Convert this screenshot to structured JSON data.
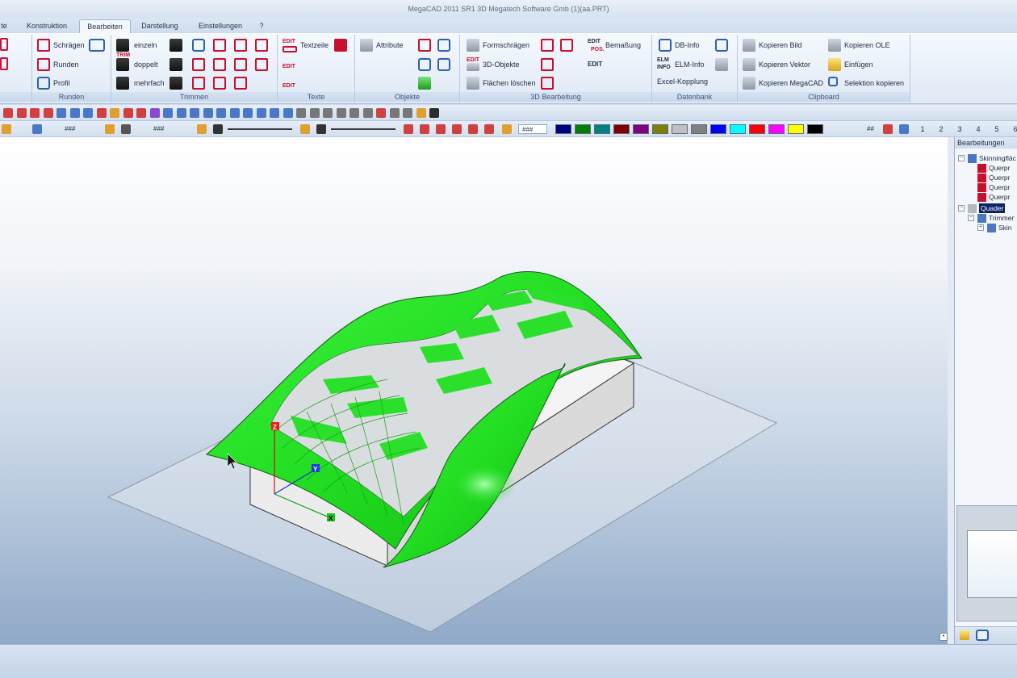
{
  "window": {
    "title": "MegaCAD 2011 SR1 3D  Megatech Software Gmb (1)(aa.PRT)"
  },
  "tabs": [
    {
      "label": "te"
    },
    {
      "label": "Konstruktion"
    },
    {
      "label": "Bearbeiten",
      "active": true
    },
    {
      "label": "Darstellung"
    },
    {
      "label": "Einstellungen"
    },
    {
      "label": "?"
    }
  ],
  "ribbon": {
    "groups": {
      "runden": {
        "label": "Runden",
        "items": [
          "Schrägen",
          "Runden",
          "Profil"
        ]
      },
      "trimmen": {
        "label": "Trimmen",
        "items": [
          "einzeln",
          "doppelt",
          "mehrfach"
        ]
      },
      "texte": {
        "label": "Texte",
        "items": [
          "Textzeile"
        ]
      },
      "objekte": {
        "label": "Objekte",
        "items": [
          "Attribute"
        ]
      },
      "bearbeitung3d": {
        "label": "3D Bearbeitung",
        "items": [
          "Formschrägen",
          "3D-Objekte",
          "Flächen löschen",
          "Bemaßung",
          "EDIT"
        ]
      },
      "datenbank": {
        "label": "Datenbank",
        "items": [
          "DB-Info",
          "ELM-Info",
          "Excel-Kopplung"
        ]
      },
      "clipboard": {
        "label": "Clipboard",
        "items": [
          "Kopieren Bild",
          "Kopieren OLE",
          "Kopieren Vektor",
          "Einfügen",
          "Kopieren MegaCAD",
          "Selektion kopieren"
        ]
      }
    },
    "icon_texts": {
      "trim": "TRIM",
      "edit": "EDIT",
      "pos": "POS.",
      "elm": "ELM",
      "info": "INFO"
    }
  },
  "toolbar2": {
    "hash1": "###",
    "hash2": "###",
    "hash3": "###",
    "grid_label": "##",
    "colors": [
      "#ffffff",
      "#000080",
      "#008000",
      "#008080",
      "#800000",
      "#800080",
      "#808000",
      "#c0c0c0",
      "#808080",
      "#0000ff",
      "#00ffff",
      "#ff0000",
      "#ff00ff",
      "#ffff00",
      "#000000"
    ],
    "layers": [
      "1",
      "2",
      "3",
      "4",
      "5",
      "6"
    ]
  },
  "viewport": {
    "accent": "#22dd22",
    "axes": {
      "x": "X",
      "y": "Y",
      "z": "Z"
    }
  },
  "panel": {
    "title": "Bearbeitungen",
    "tree": [
      {
        "label": "Skinningfläc",
        "level": 0,
        "expander": "⊟"
      },
      {
        "label": "Querpr",
        "level": 1
      },
      {
        "label": "Querpr",
        "level": 1
      },
      {
        "label": "Querpr",
        "level": 1
      },
      {
        "label": "Querpr",
        "level": 1
      },
      {
        "label": "Quader",
        "level": 0,
        "expander": "⊟",
        "selected": true
      },
      {
        "label": "Trimmer",
        "level": 1,
        "expander": "⊟"
      },
      {
        "label": "Skin",
        "level": 2,
        "expander": "⊞"
      }
    ]
  }
}
